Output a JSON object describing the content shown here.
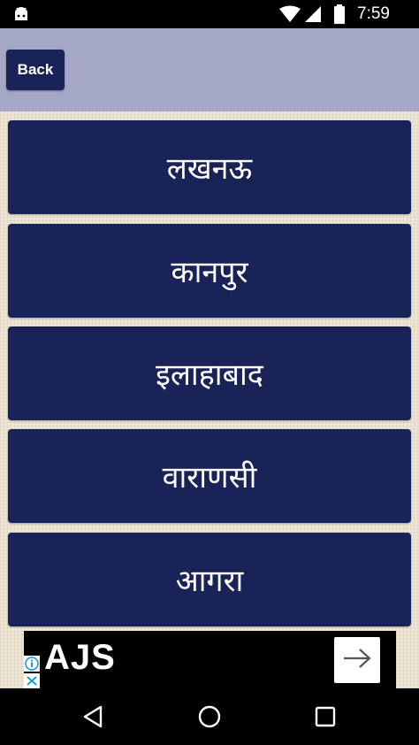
{
  "status_bar": {
    "time": "7:59",
    "icons": [
      "android-icon",
      "wifi-icon",
      "signal-icon",
      "battery-icon"
    ]
  },
  "header": {
    "back_label": "Back",
    "background_color": "#a4a7c6",
    "button_color": "#1a2357"
  },
  "cities": [
    {
      "label": "लखनऊ"
    },
    {
      "label": "कानपुर"
    },
    {
      "label": "इलाहाबाद"
    },
    {
      "label": "वाराणसी"
    },
    {
      "label": "आगरा"
    }
  ],
  "ad": {
    "title": "AJS",
    "icons": [
      "info-icon",
      "close-icon",
      "arrow-right-icon"
    ]
  },
  "nav_bar": {
    "icons": [
      "back-triangle-icon",
      "home-circle-icon",
      "recents-square-icon"
    ]
  }
}
